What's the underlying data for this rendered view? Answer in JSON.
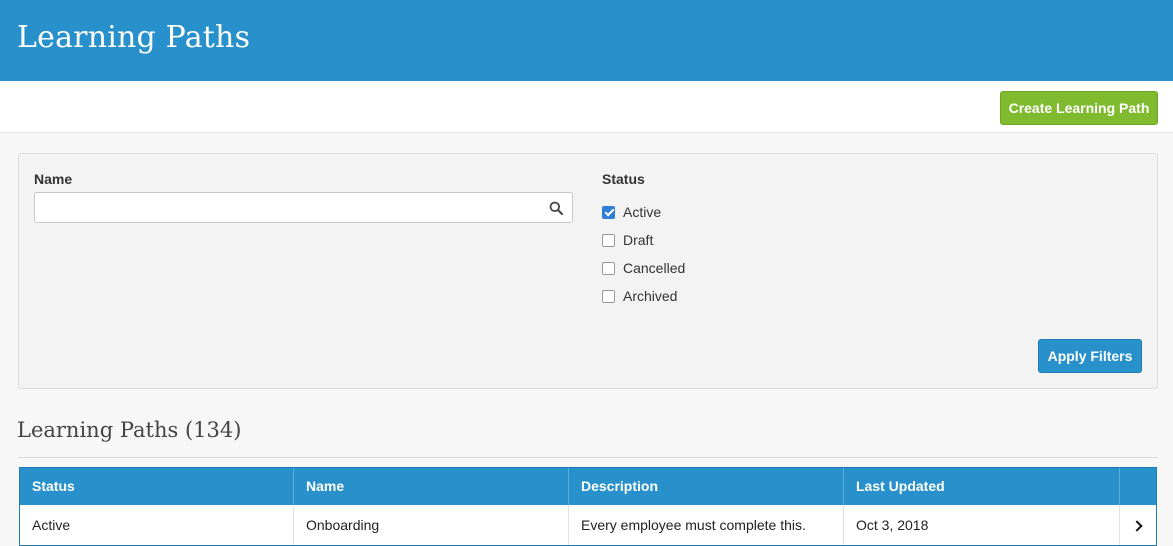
{
  "header": {
    "title": "Learning Paths"
  },
  "actions": {
    "create_label": "Create Learning Path"
  },
  "filters": {
    "name_label": "Name",
    "name_value": "",
    "status_label": "Status",
    "status_options": [
      {
        "label": "Active",
        "checked": true
      },
      {
        "label": "Draft",
        "checked": false
      },
      {
        "label": "Cancelled",
        "checked": false
      },
      {
        "label": "Archived",
        "checked": false
      }
    ],
    "apply_label": "Apply Filters"
  },
  "results": {
    "heading": "Learning Paths (134)",
    "columns": [
      "Status",
      "Name",
      "Description",
      "Last Updated",
      ""
    ],
    "rows": [
      {
        "status": "Active",
        "name": "Onboarding",
        "description": "Every employee must complete this.",
        "last_updated": "Oct 3, 2018"
      }
    ]
  },
  "colors": {
    "primary": "#2891cb",
    "create_button": "#80bb2f",
    "checkbox_checked": "#2f7fd6"
  },
  "icons": {
    "search": "search-icon",
    "row_open": "chevron-right-icon"
  }
}
